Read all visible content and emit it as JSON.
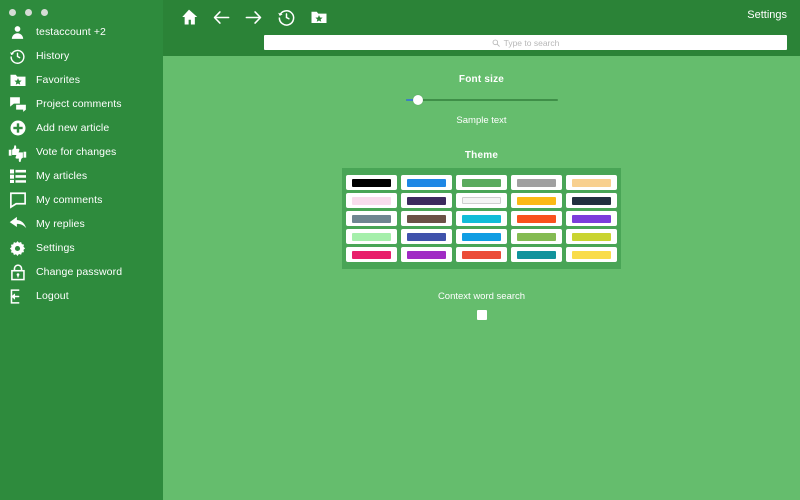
{
  "window": {
    "dots": [
      "close-dot",
      "minimize-dot",
      "maximize-dot"
    ]
  },
  "sidebar": {
    "account": {
      "label": "testaccount  +2",
      "icon": "person-icon"
    },
    "items": [
      {
        "label": "History",
        "icon": "clock-history-icon"
      },
      {
        "label": "Favorites",
        "icon": "folder-star-icon"
      },
      {
        "label": "Project comments",
        "icon": "comments-icon"
      },
      {
        "label": "Add new article",
        "icon": "plus-circle-icon"
      },
      {
        "label": "Vote for changes",
        "icon": "thumbs-up-down-icon"
      },
      {
        "label": "My articles",
        "icon": "list-icon"
      },
      {
        "label": "My comments",
        "icon": "speech-bubble-icon"
      },
      {
        "label": "My replies",
        "icon": "reply-arrow-icon"
      },
      {
        "label": "Settings",
        "icon": "gear-icon"
      },
      {
        "label": "Change password",
        "icon": "lock-icon"
      },
      {
        "label": "Logout",
        "icon": "logout-icon"
      }
    ]
  },
  "header": {
    "icons": [
      {
        "name": "home-icon"
      },
      {
        "name": "arrow-left-icon"
      },
      {
        "name": "arrow-right-icon"
      },
      {
        "name": "history-icon"
      },
      {
        "name": "folder-star-icon"
      }
    ],
    "settings_label": "Settings",
    "search": {
      "placeholder": "Type to search",
      "value": "",
      "icon": "search-icon"
    }
  },
  "main": {
    "font_size": {
      "title": "Font size",
      "sample_text": "Sample text",
      "slider_value": 8,
      "slider_min": 0,
      "slider_max": 100,
      "fill_color": "#3e7fc4",
      "track_color": "#3f8f48",
      "thumb_color": "#ffffff"
    },
    "theme": {
      "title": "Theme",
      "panel_color": "#49a556",
      "swatches": [
        [
          "#000000",
          "#1e87e5",
          "#5aab5e",
          "#a0a0a0",
          "#f8d08f"
        ],
        [
          "#f9dced",
          "#3c2a5e",
          "#f4f4f4",
          "#fbb915",
          "#22303f"
        ],
        [
          "#6f8691",
          "#6b5146",
          "#11bdd8",
          "#f9511d",
          "#7c3ddb"
        ],
        [
          "#a5efab",
          "#3f52ab",
          "#0f9de3",
          "#84bb52",
          "#c9d430"
        ],
        [
          "#e8206b",
          "#a02bc4",
          "#eb4c38",
          "#11939c",
          "#f9dc4a"
        ]
      ]
    },
    "context_word_search": {
      "label": "Context word search",
      "checked": false
    }
  },
  "colors": {
    "sidebar_bg": "#2e8b3d",
    "header_bg": "#2b8337",
    "content_bg": "#65bd6d",
    "text": "#ffffff"
  }
}
